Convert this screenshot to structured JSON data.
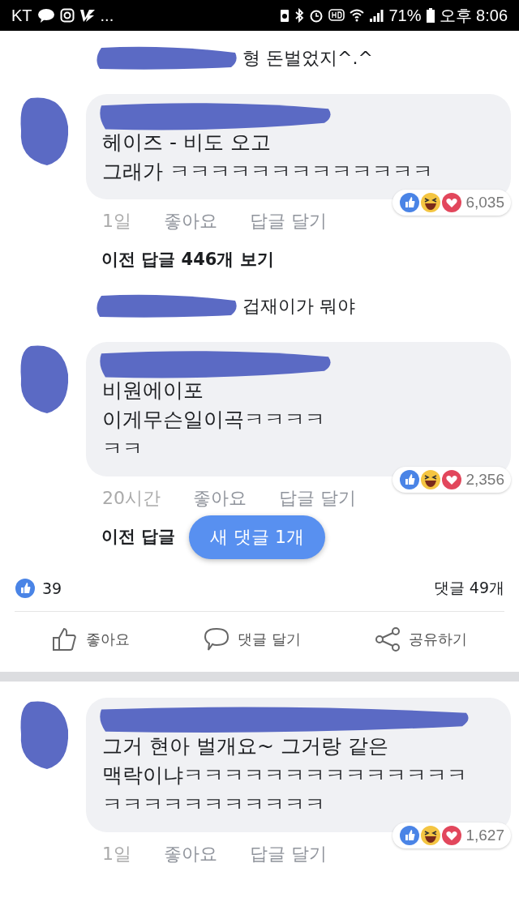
{
  "status_bar": {
    "carrier": "KT",
    "more": "...",
    "battery": "71%",
    "time": "오후 8:06"
  },
  "thread_top": [
    {
      "kind": "reply",
      "text": "형 돈벌었지^.^"
    },
    {
      "kind": "comment",
      "lines": [
        "헤이즈 - 비도 오고",
        "그래가 ㅋㅋㅋㅋㅋㅋㅋㅋㅋㅋㅋㅋㅋ"
      ],
      "reactions": "6,035",
      "time": "1일",
      "like": "좋아요",
      "reply": "답글 달기"
    },
    {
      "kind": "more",
      "text": "이전 답글 446개 보기"
    },
    {
      "kind": "reply",
      "text": "겁재이가 뭐야"
    },
    {
      "kind": "comment",
      "lines": [
        "비원에이포",
        "이게무슨일이곡ㅋㅋㅋㅋ",
        "ㅋㅋ"
      ],
      "reactions": "2,356",
      "time": "20시간",
      "like": "좋아요",
      "reply": "답글 달기"
    },
    {
      "kind": "more",
      "text": "이전 답글"
    }
  ],
  "new_comments_button": "새 댓글 1개",
  "post_footer": {
    "likes": "39",
    "comments": "댓글 49개",
    "actions": [
      {
        "kind": "like",
        "label": "좋아요"
      },
      {
        "kind": "comment",
        "label": "댓글 달기"
      },
      {
        "kind": "share",
        "label": "공유하기"
      }
    ]
  },
  "thread_bottom": [
    {
      "kind": "comment",
      "lines": [
        "그거 현아 벌개요~ 그거랑 같은",
        "맥락이냐ㅋㅋㅋㅋㅋㅋㅋㅋㅋㅋㅋㅋㅋㅋ",
        "ㅋㅋㅋㅋㅋㅋㅋㅋㅋㅋㅋ"
      ],
      "reactions": "1,627",
      "time": "1일",
      "like": "좋아요",
      "reply": "답글 달기"
    }
  ]
}
